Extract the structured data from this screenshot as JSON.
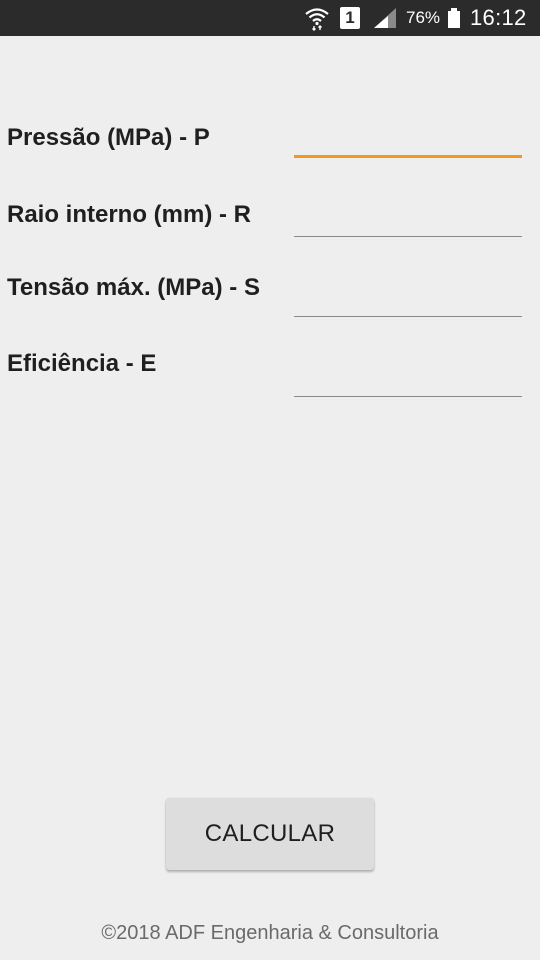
{
  "status_bar": {
    "wifi_icon": "wifi-data-icon",
    "sim_label": "1",
    "signal_icon": "cell-signal-icon",
    "battery_percent": "76%",
    "battery_icon": "battery-icon",
    "time": "16:12"
  },
  "form": {
    "fields": [
      {
        "label": "Pressão (MPa) - P",
        "value": "",
        "focused": true
      },
      {
        "label": "Raio interno (mm) - R",
        "value": "",
        "focused": false
      },
      {
        "label": "Tensão máx. (MPa) - S",
        "value": "",
        "focused": false
      },
      {
        "label": "Eficiência - E",
        "value": "",
        "focused": false
      }
    ]
  },
  "calculate_button": {
    "label": "CALCULAR"
  },
  "footer": {
    "text": "©2018 ADF Engenharia & Consultoria"
  },
  "colors": {
    "background": "#eeeeee",
    "status_bar": "#2b2b2b",
    "focus_accent": "#f09a1a",
    "button": "#dddddd"
  }
}
